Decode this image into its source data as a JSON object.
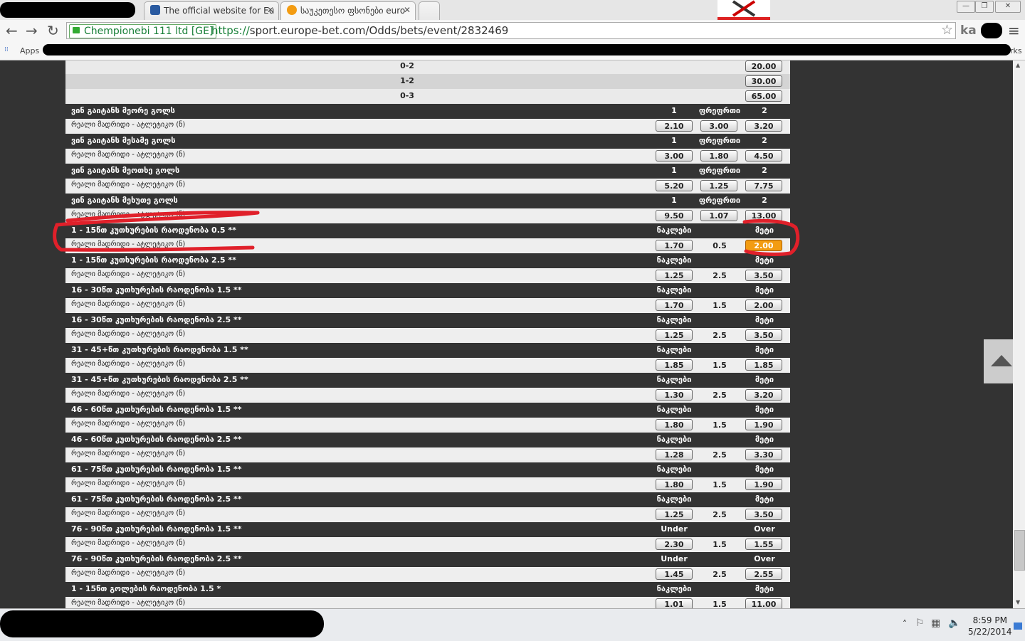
{
  "browser": {
    "tabs": [
      {
        "title": "",
        "redacted": true
      },
      {
        "title": "The official website for Eu",
        "favicon": "#2a5aa0"
      },
      {
        "title": "საუკეთესო ფსონები euro",
        "favicon": "#f39c12"
      }
    ],
    "profile": "ka",
    "address": {
      "secure_label": "Chempionebi 111 ltd [GE]",
      "url_scheme": "https://",
      "url_rest": "sport.europe-bet.com/Odds/bets/event/2832469"
    },
    "bookmarks": {
      "apps_label": "Apps",
      "other_label": "Other bookmarks"
    }
  },
  "odds": {
    "scores": [
      {
        "label": "0-2",
        "odd": "20.00"
      },
      {
        "label": "1-2",
        "odd": "30.00"
      },
      {
        "label": "0-3",
        "odd": "65.00"
      }
    ],
    "event": "რეალი მადრიდი - ატლეტიკო (ნ)",
    "markets": [
      {
        "title": "ვინ გაიტანს მეორე გოლს",
        "h1": "1",
        "h2": "ფრეფრთი",
        "h3": "2",
        "o1": "2.10",
        "mid": "3.00",
        "o3": "3.20",
        "mid_is_odd": true
      },
      {
        "title": "ვინ გაიტანს მესამე გოლს",
        "h1": "1",
        "h2": "ფრეფრთი",
        "h3": "2",
        "o1": "3.00",
        "mid": "1.80",
        "o3": "4.50",
        "mid_is_odd": true
      },
      {
        "title": "ვინ გაიტანს მეოთხე გოლს",
        "h1": "1",
        "h2": "ფრეფრთი",
        "h3": "2",
        "o1": "5.20",
        "mid": "1.25",
        "o3": "7.75",
        "mid_is_odd": true
      },
      {
        "title": "ვინ გაიტანს მეხუთე გოლს",
        "h1": "1",
        "h2": "ფრეფრთი",
        "h3": "2",
        "o1": "9.50",
        "mid": "1.07",
        "o3": "13.00",
        "mid_is_odd": true
      },
      {
        "title": "1 - 15წთ კუთხურების რაოდენობა 0.5 **",
        "h1": "ნაკლები",
        "h2": "",
        "h3": "მეტი",
        "o1": "1.70",
        "mid": "0.5",
        "o3": "2.00",
        "selected": true
      },
      {
        "title": "1 - 15წთ კუთხურების რაოდენობა 2.5 **",
        "h1": "ნაკლები",
        "h2": "",
        "h3": "მეტი",
        "o1": "1.25",
        "mid": "2.5",
        "o3": "3.50"
      },
      {
        "title": "16 - 30წთ კუთხურების რაოდენობა 1.5 **",
        "h1": "ნაკლები",
        "h2": "",
        "h3": "მეტი",
        "o1": "1.70",
        "mid": "1.5",
        "o3": "2.00"
      },
      {
        "title": "16 - 30წთ კუთხურების რაოდენობა 2.5 **",
        "h1": "ნაკლები",
        "h2": "",
        "h3": "მეტი",
        "o1": "1.25",
        "mid": "2.5",
        "o3": "3.50"
      },
      {
        "title": "31 - 45+წთ კუთხურების რაოდენობა 1.5 **",
        "h1": "ნაკლები",
        "h2": "",
        "h3": "მეტი",
        "o1": "1.85",
        "mid": "1.5",
        "o3": "1.85"
      },
      {
        "title": "31 - 45+წთ კუთხურების რაოდენობა 2.5 **",
        "h1": "ნაკლები",
        "h2": "",
        "h3": "მეტი",
        "o1": "1.30",
        "mid": "2.5",
        "o3": "3.20"
      },
      {
        "title": "46 - 60წთ კუთხურების რაოდენობა 1.5 **",
        "h1": "ნაკლები",
        "h2": "",
        "h3": "მეტი",
        "o1": "1.80",
        "mid": "1.5",
        "o3": "1.90"
      },
      {
        "title": "46 - 60წთ კუთხურების რაოდენობა 2.5 **",
        "h1": "ნაკლები",
        "h2": "",
        "h3": "მეტი",
        "o1": "1.28",
        "mid": "2.5",
        "o3": "3.30"
      },
      {
        "title": "61 - 75წთ კუთხურების რაოდენობა 1.5 **",
        "h1": "ნაკლები",
        "h2": "",
        "h3": "მეტი",
        "o1": "1.80",
        "mid": "1.5",
        "o3": "1.90"
      },
      {
        "title": "61 - 75წთ კუთხურების რაოდენობა 2.5 **",
        "h1": "ნაკლები",
        "h2": "",
        "h3": "მეტი",
        "o1": "1.25",
        "mid": "2.5",
        "o3": "3.50"
      },
      {
        "title": "76 - 90წთ კუთხურების რაოდენობა 1.5 **",
        "h1": "Under",
        "h2": "",
        "h3": "Over",
        "o1": "2.30",
        "mid": "1.5",
        "o3": "1.55"
      },
      {
        "title": "76 - 90წთ კუთხურების რაოდენობა 2.5 **",
        "h1": "Under",
        "h2": "",
        "h3": "Over",
        "o1": "1.45",
        "mid": "2.5",
        "o3": "2.55"
      },
      {
        "title": "1 - 15წთ გოლების რაოდენობა 1.5 *",
        "h1": "ნაკლები",
        "h2": "",
        "h3": "მეტი",
        "o1": "1.01",
        "mid": "1.5",
        "o3": "11.00"
      }
    ]
  },
  "taskbar": {
    "time": "8:59 PM",
    "date": "5/22/2014"
  },
  "colors": {
    "selected_odd": "#f39c12",
    "annotation": "#e0202a",
    "header_row": "#333333",
    "event_row": "#eeeeee"
  }
}
